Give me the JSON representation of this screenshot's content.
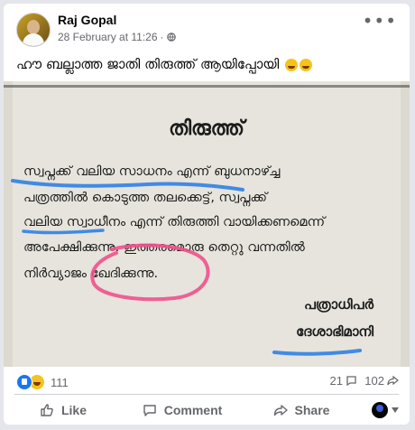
{
  "post": {
    "author": "Raj Gopal",
    "timestamp": "28 February at 11:26",
    "separator": "·",
    "audience_icon": "globe-icon",
    "more_label": "•••",
    "caption": "ഹൗ ബല്ലാത്ത ജാതി തിരുത്ത് ആയിപ്പോയി"
  },
  "image": {
    "title": "തിരുത്ത്",
    "lines": [
      "സ്വപ്നക്ക് വലിയ സാധനം എന്ന് ബുധനാഴ്ച്ച",
      "പത്രത്തിൽ കൊടുത്ത തലക്കെട്ട്, സ്വപ്നക്ക്",
      "വലിയ സ്വാധീനം എന്ന് തിരുത്തി വായിക്കണമെന്ന്",
      "അപേക്ഷിക്കുന്നു. ഇത്തരമൊരു തെറ്റു വന്നതിൽ",
      "നിർവ്യാജം ഖേദിക്കുന്നു."
    ],
    "signature_title": "പത്രാധിപർ",
    "signature_paper": "ദേശാഭിമാനി",
    "colors": {
      "underline": "#2f7fe6",
      "circle": "#f0508c",
      "paper": "#e6e4dc"
    }
  },
  "stats": {
    "reaction_count": "111",
    "reaction_icons": [
      "like-reaction-icon",
      "haha-reaction-icon"
    ],
    "comment_count": "21",
    "share_count": "102"
  },
  "actions": {
    "like": "Like",
    "comment": "Comment",
    "share": "Share"
  },
  "colors": {
    "accent": "#1877f2",
    "muted": "#65676b",
    "text": "#050505"
  }
}
